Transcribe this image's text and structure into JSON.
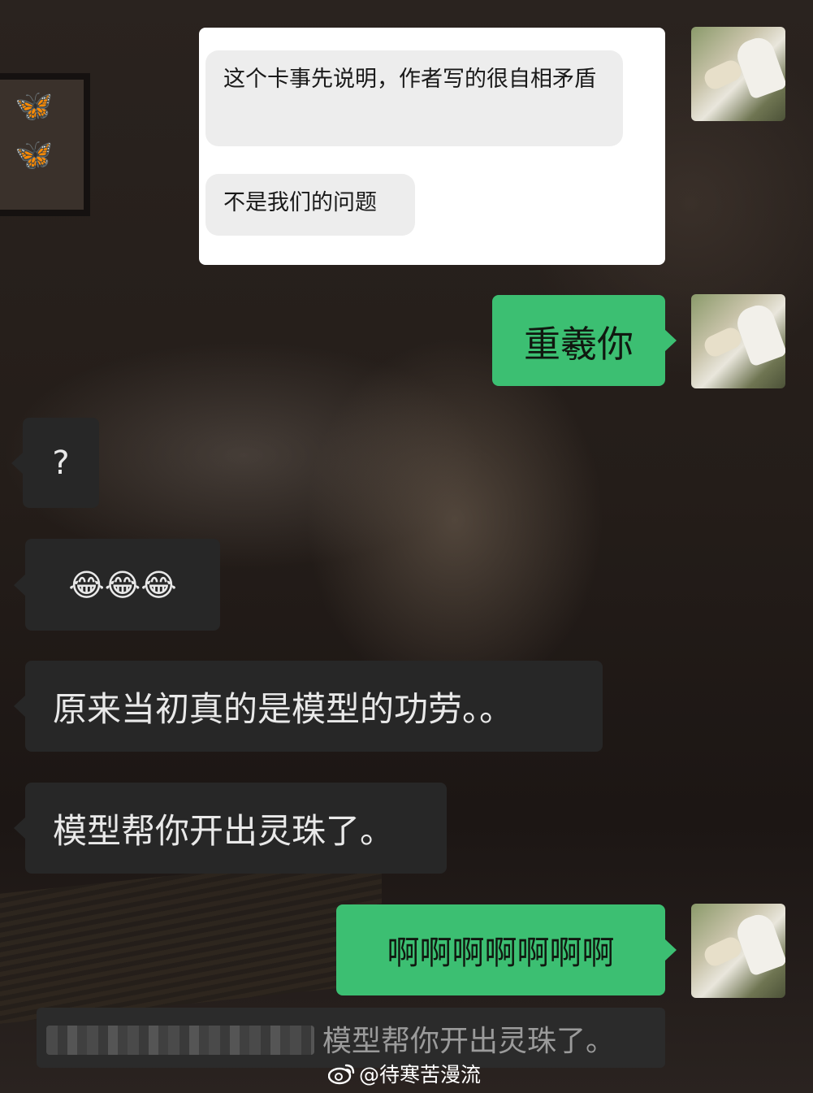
{
  "card": {
    "messages": [
      "这个卡事先说明，作者写的很自相矛盾",
      "不是我们的问题"
    ]
  },
  "messages": [
    {
      "side": "right",
      "text": "重羲你"
    },
    {
      "side": "left",
      "text": "?"
    },
    {
      "side": "left",
      "text": "😂😂😂"
    },
    {
      "side": "left",
      "text": "原来当初真的是模型的功劳。。"
    },
    {
      "side": "left",
      "text": "模型帮你开出灵珠了。"
    },
    {
      "side": "right",
      "text": "啊啊啊啊啊啊啊"
    }
  ],
  "quote": {
    "text": "模型帮你开出灵珠了。"
  },
  "watermark": {
    "handle": "@待寒苦漫流"
  },
  "colors": {
    "green_bubble": "#3cbf72",
    "dark_bubble": "#272727",
    "card_background": "#ffffff"
  },
  "icons": [
    "weibo-icon",
    "avatar"
  ]
}
